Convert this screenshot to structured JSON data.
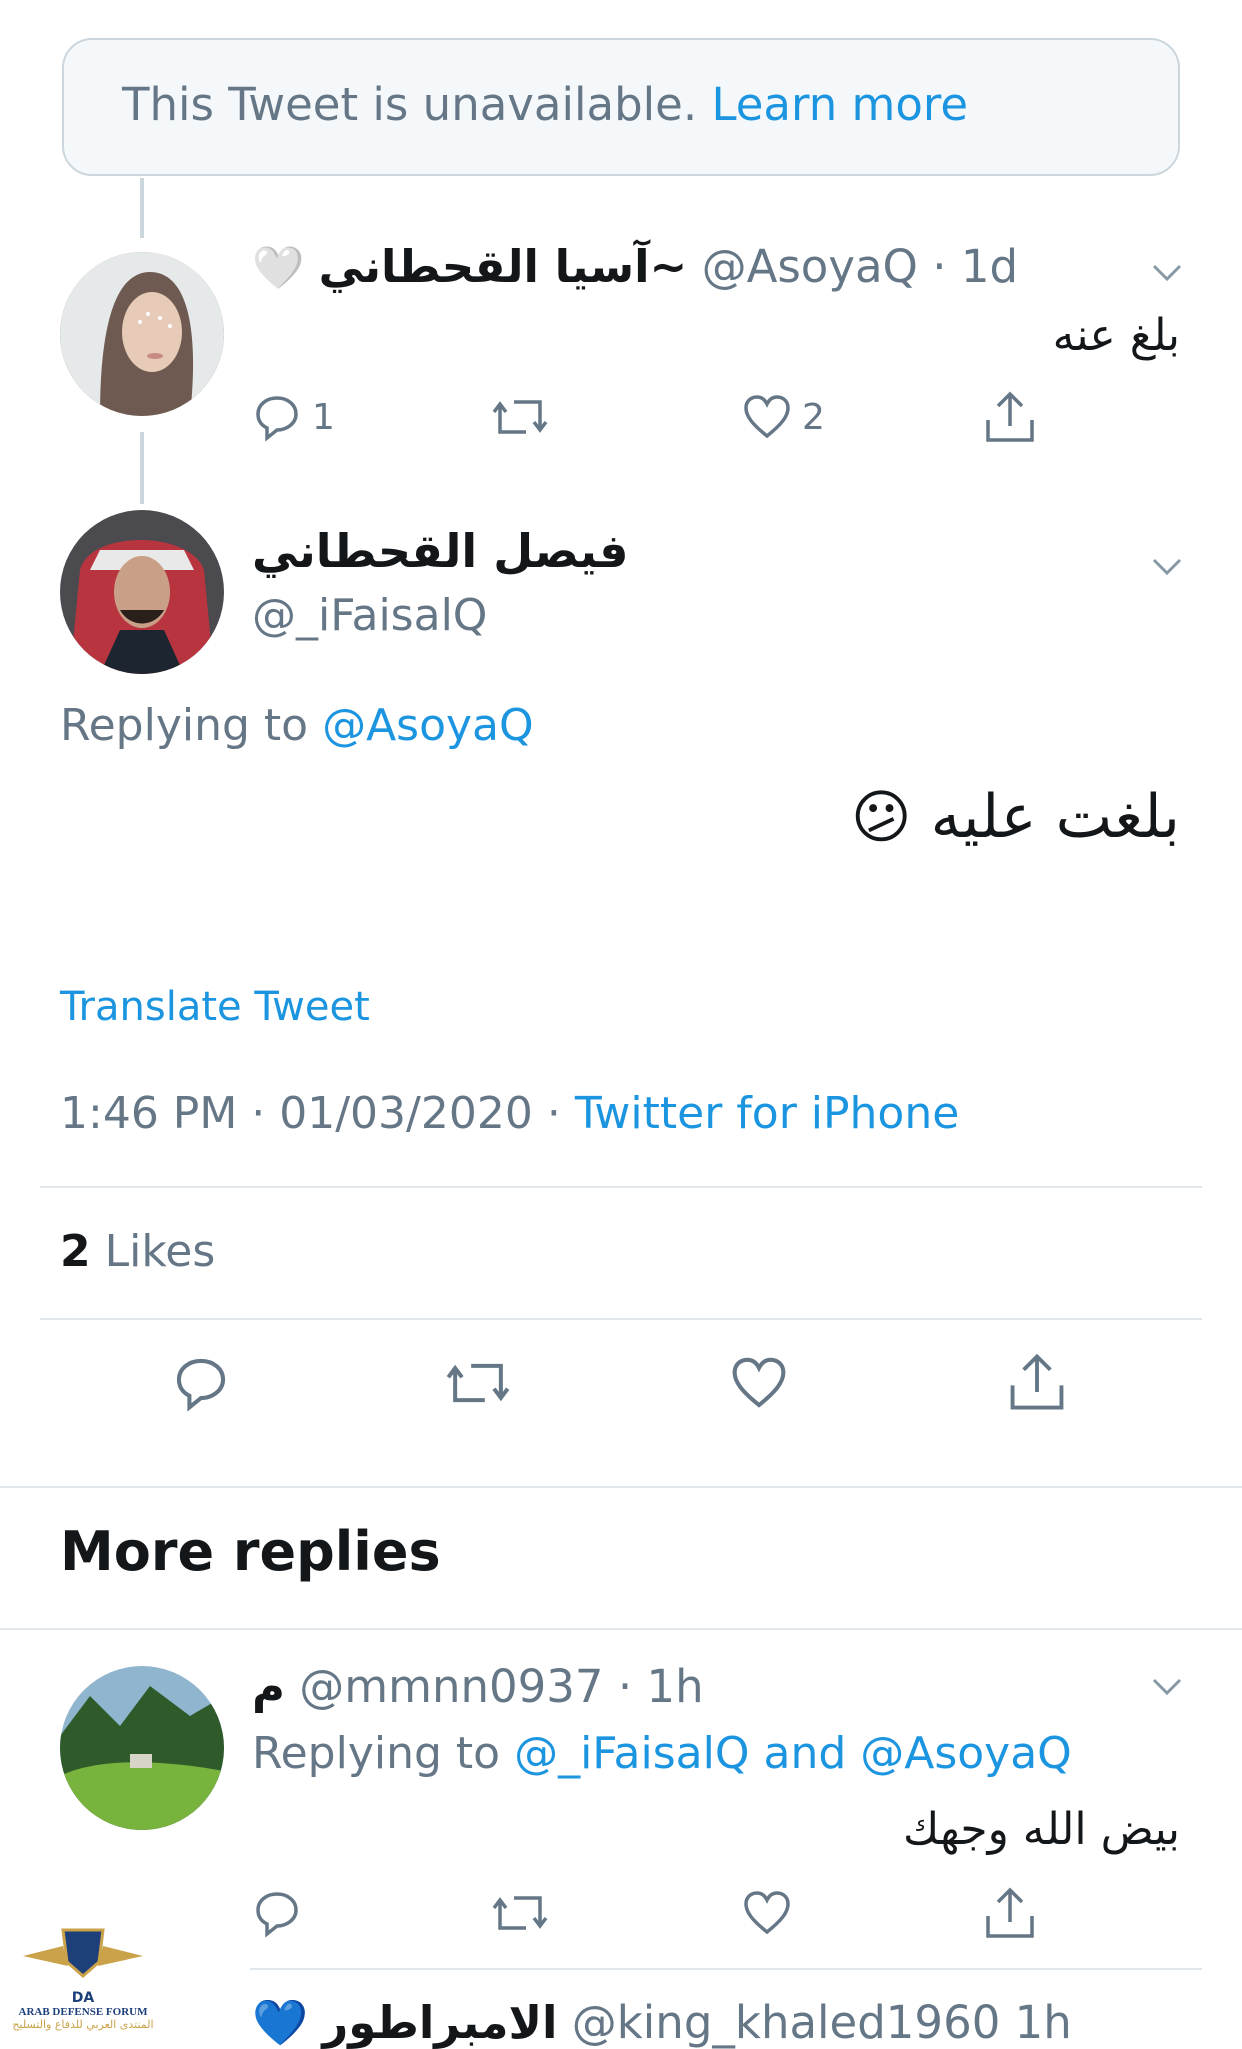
{
  "unavailable": {
    "text": "This Tweet is unavailable.",
    "link": "Learn more"
  },
  "tweet1": {
    "display_name": "آسيا القحطاني~",
    "emoji": "🤍",
    "handle": "@AsoyaQ",
    "dot": "·",
    "time": "1d",
    "body": "بلغ عنه",
    "reply_count": "1",
    "like_count": "2"
  },
  "main_tweet": {
    "display_name": "فيصل القحطاني",
    "handle": "@_iFaisalQ",
    "replying_label": "Replying to",
    "replying_to": "@AsoyaQ",
    "body": "بلغت عليه",
    "emoji": "😕",
    "translate": "Translate Tweet",
    "timestamp": "1:46 PM · 01/03/2020 ·",
    "source": "Twitter for iPhone",
    "likes_count": "2",
    "likes_label": "Likes"
  },
  "more_replies": {
    "heading": "More replies",
    "reply1": {
      "display_name": "م",
      "handle": "@mmnn0937",
      "dot": "·",
      "time": "1h",
      "replying_label": "Replying to",
      "replying_to": "@_iFaisalQ and @AsoyaQ",
      "body": "بيض الله وجهك"
    },
    "reply2_partial": {
      "emoji": "💙",
      "display_name": "الامبراطور",
      "handle": "@king_khaled1960",
      "time": "1h"
    }
  },
  "watermark": {
    "line1": "ARAB DEFENSE FORUM",
    "line2": "المنتدى العربي للدفاع والتسليح",
    "logo": "DA"
  },
  "icons": [
    "chevron-down-icon",
    "reply-icon",
    "retweet-icon",
    "like-icon",
    "share-icon"
  ],
  "colors": {
    "link_blue": "#1b95e0",
    "grey_text": "#657786",
    "border": "#e1e8ed"
  }
}
